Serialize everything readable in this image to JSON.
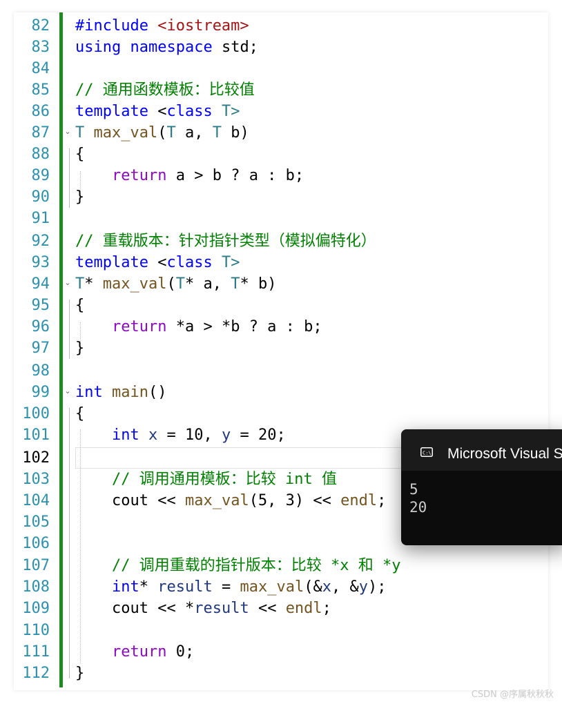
{
  "editor": {
    "line_numbers": [
      "82",
      "83",
      "84",
      "85",
      "86",
      "87",
      "88",
      "89",
      "90",
      "91",
      "92",
      "93",
      "94",
      "95",
      "96",
      "97",
      "98",
      "99",
      "100",
      "101",
      "102",
      "103",
      "104",
      "105",
      "106",
      "107",
      "108",
      "109",
      "110",
      "111",
      "112"
    ],
    "current_line": "102",
    "code": {
      "l82_a": "#include ",
      "l82_b": "<iostream>",
      "l83_a": "using",
      "l83_b": "namespace",
      "l83_c": " std;",
      "l85": "// 通用函数模板：比较值",
      "l86_a": "template",
      "l86_b": " <",
      "l86_c": "class",
      "l86_d": " T>",
      "l87_a": "T",
      "l87_b": "max_val",
      "l87_c": "(",
      "l87_d": "T",
      "l87_e": " a, ",
      "l87_f": "T",
      "l87_g": " b)",
      "l88": "{",
      "l89_a": "return",
      "l89_b": " a > b ? a : b;",
      "l90": "}",
      "l92": "// 重载版本：针对指针类型（模拟偏特化）",
      "l93_a": "template",
      "l93_b": " <",
      "l93_c": "class",
      "l93_d": " T>",
      "l94_a": "T",
      "l94_b": "* ",
      "l94_c": "max_val",
      "l94_d": "(",
      "l94_e": "T",
      "l94_f": "* a, ",
      "l94_g": "T",
      "l94_h": "* b)",
      "l95": "{",
      "l96_a": "return",
      "l96_b": " *a > *b ? a : b;",
      "l97": "}",
      "l99_a": "int",
      "l99_b": "main",
      "l99_c": "()",
      "l100": "{",
      "l101_a": "int",
      "l101_b": " x",
      "l101_c": " = 10, ",
      "l101_d": "y",
      "l101_e": " = 20;",
      "l103": "// 调用通用模板：比较 int 值",
      "l104_a": "cout",
      "l104_b": " << ",
      "l104_c": "max_val",
      "l104_d": "(5, 3) << ",
      "l104_e": "endl",
      "l104_f": ";",
      "l107": "// 调用重载的指针版本：比较 *x 和 *y",
      "l108_a": "int",
      "l108_b": "* ",
      "l108_c": "result",
      "l108_d": " = ",
      "l108_e": "max_val",
      "l108_f": "(&",
      "l108_g": "x",
      "l108_h": ", &",
      "l108_i": "y",
      "l108_j": ");",
      "l109_a": "cout",
      "l109_b": " << *",
      "l109_c": "result",
      "l109_d": " << ",
      "l109_e": "endl",
      "l109_f": ";",
      "l111_a": "return",
      "l111_b": " 0;",
      "l112": "}"
    }
  },
  "console": {
    "title": "Microsoft Visual Studio Debug Console",
    "icon": "console-icon",
    "output": [
      "5",
      "20"
    ]
  },
  "watermark": "CSDN @序属秋秋秋",
  "colors": {
    "keyword": "#0000ff",
    "control_keyword": "#8f08c4",
    "type": "#2b7a8b",
    "function": "#74531f",
    "string": "#a31515",
    "comment": "#008000",
    "change_bar": "#1f8a1f",
    "line_number": "#2b91af",
    "console_bg": "#0c0c0c"
  }
}
